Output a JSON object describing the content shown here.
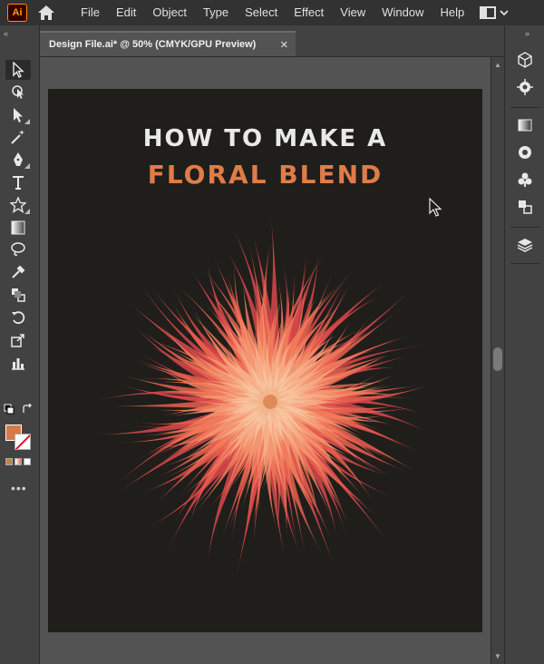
{
  "app": {
    "logo_text": "Ai"
  },
  "menu": [
    "File",
    "Edit",
    "Object",
    "Type",
    "Select",
    "Effect",
    "View",
    "Window",
    "Help"
  ],
  "document": {
    "tab_title": "Design File.ai* @ 50% (CMYK/GPU Preview)",
    "close_glyph": "✕"
  },
  "artwork": {
    "title_line1": "HOW TO MAKE A",
    "title_line2": "FLORAL BLEND"
  },
  "colors": {
    "fill": "#d77a4a",
    "title_accent": "#e07c48",
    "artboard_bg": "#1f1e1b"
  },
  "toolbar": {
    "tools": [
      "selection-tool",
      "direct-selection-tool",
      "pen-tool",
      "curvature-tool",
      "type-tool",
      "rectangle-tool",
      "shape-builder-tool",
      "paintbrush-tool",
      "rotate-tool",
      "scale-tool",
      "eyedropper-tool",
      "blend-tool",
      "artboard-tool",
      "more-tools"
    ],
    "more_label": "•••"
  },
  "dock": [
    "libraries-icon",
    "properties-icon",
    "gradient-icon",
    "color-guide-icon",
    "symbols-icon",
    "align-icon",
    "layers-icon"
  ]
}
